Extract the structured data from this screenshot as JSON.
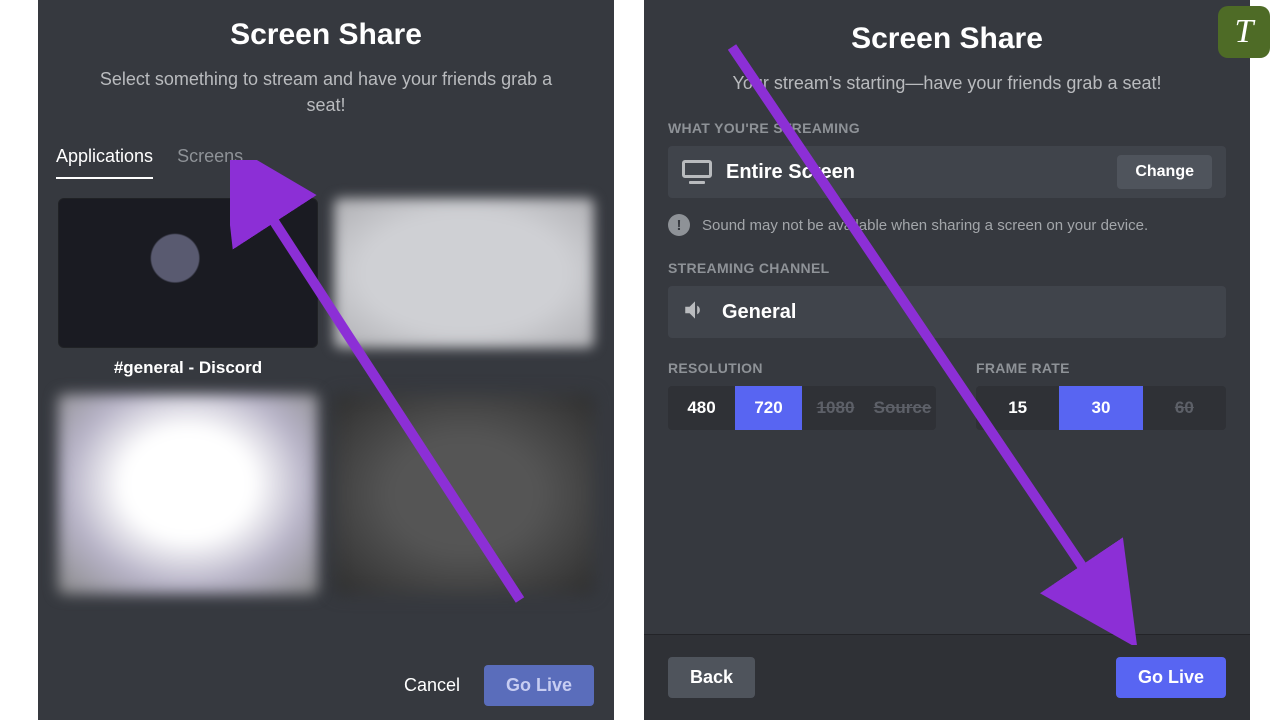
{
  "left": {
    "title": "Screen Share",
    "subtitle": "Select something to stream and have your friends grab a seat!",
    "tabs": {
      "applications": "Applications",
      "screens": "Screens"
    },
    "app_thumb_label": "#general - Discord",
    "footer": {
      "cancel": "Cancel",
      "go_live": "Go Live"
    }
  },
  "right": {
    "title": "Screen Share",
    "subtitle": "Your stream's starting—have your friends grab a seat!",
    "what_label": "WHAT YOU'RE STREAMING",
    "source_name": "Entire Screen",
    "change": "Change",
    "sound_warning": "Sound may not be available when sharing a screen on your device.",
    "channel_label": "STREAMING CHANNEL",
    "channel_name": "General",
    "resolution_label": "RESOLUTION",
    "framerate_label": "FRAME RATE",
    "res": {
      "r480": "480",
      "r720": "720",
      "r1080": "1080",
      "source": "Source"
    },
    "fps": {
      "f15": "15",
      "f30": "30",
      "f60": "60"
    },
    "footer": {
      "back": "Back",
      "go_live": "Go Live"
    }
  },
  "badge": "T"
}
